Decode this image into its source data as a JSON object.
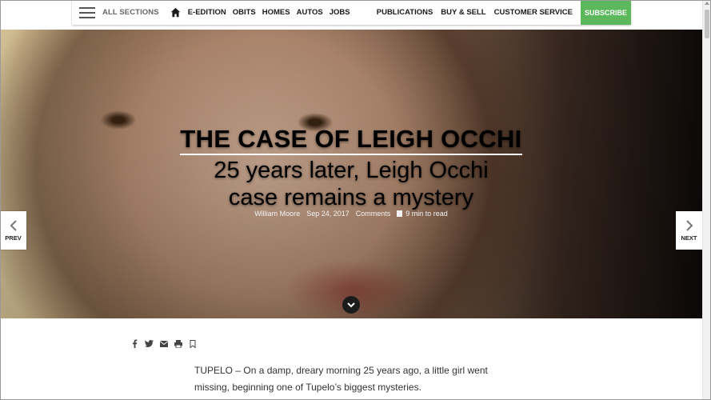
{
  "nav": {
    "all_sections": "ALL SECTIONS",
    "left_links": [
      "E-EDITION",
      "OBITS",
      "HOMES",
      "AUTOS",
      "JOBS"
    ],
    "right_links": [
      "PUBLICATIONS",
      "BUY & SELL",
      "CUSTOMER SERVICE"
    ],
    "subscribe": "SUBSCRIBE",
    "subscribe_color": "#5cb85c"
  },
  "hero": {
    "kicker": "THE CASE OF LEIGH OCCHI",
    "headline_line1": "25 years later, Leigh Occhi",
    "headline_line2": "case remains a mystery",
    "author": "William Moore",
    "date": "Sep 24, 2017",
    "comments": "Comments",
    "read_time": "9 min to read"
  },
  "pager": {
    "prev": "PREV",
    "next": "NEXT"
  },
  "share_icons": [
    "facebook-icon",
    "twitter-icon",
    "email-icon",
    "print-icon",
    "bookmark-icon"
  ],
  "article": {
    "paragraph_1": "TUPELO – On a damp, dreary morning 25 years ago, a little girl went missing, beginning one of Tupelo’s biggest mysteries."
  }
}
